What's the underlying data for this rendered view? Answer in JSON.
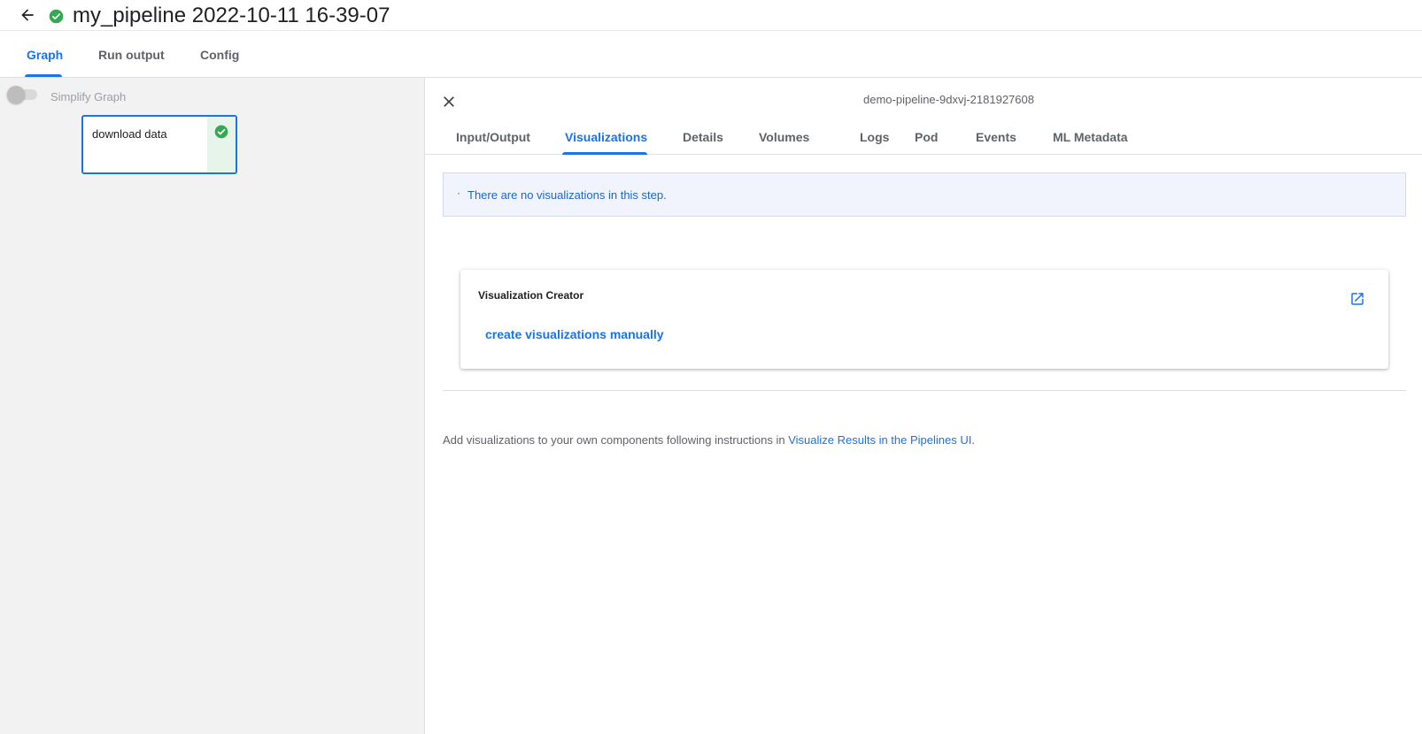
{
  "header": {
    "back_icon": "arrow-back-icon",
    "status_icon": "check-circle-icon",
    "title": "my_pipeline 2022-10-11 16-39-07"
  },
  "main_tabs": [
    {
      "label": "Graph",
      "active": true
    },
    {
      "label": "Run output",
      "active": false
    },
    {
      "label": "Config",
      "active": false
    }
  ],
  "graph": {
    "simplify_label": "Simplify Graph",
    "simplify_on": false,
    "nodes": [
      {
        "label": "download data",
        "status": "succeeded",
        "status_icon": "check-circle-icon"
      }
    ]
  },
  "side_panel": {
    "close_icon": "close-icon",
    "pod_name": "demo-pipeline-9dxvj-2181927608",
    "tabs": [
      {
        "label": "Input/Output",
        "active": false
      },
      {
        "label": "Visualizations",
        "active": true
      },
      {
        "label": "Details",
        "active": false
      },
      {
        "label": "Volumes",
        "active": false
      },
      {
        "label": "Logs",
        "active": false
      },
      {
        "label": "Pod",
        "active": false
      },
      {
        "label": "Events",
        "active": false
      },
      {
        "label": "ML Metadata",
        "active": false
      }
    ],
    "info_bullet": "·",
    "info_message": "There are no visualizations in this step.",
    "viz_creator": {
      "title": "Visualization Creator",
      "link": "create visualizations manually",
      "open_icon": "open-in-new-icon"
    },
    "footer": {
      "text": "Add visualizations to your own components following instructions in ",
      "link": "Visualize Results in the Pipelines UI",
      "suffix": "."
    }
  },
  "colors": {
    "accent": "#1a73e8",
    "success": "#34a853",
    "info_bg": "#f1f3fd",
    "graph_bg": "#f2f2f2"
  }
}
